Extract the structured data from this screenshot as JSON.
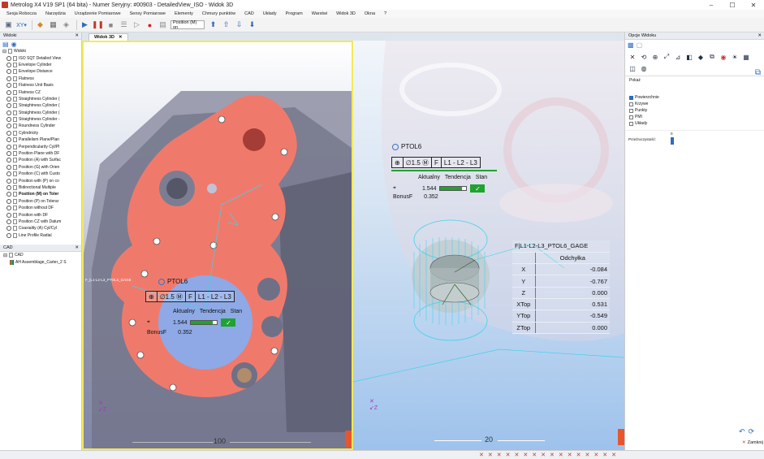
{
  "window": {
    "title": "Metrolog X4 V19 SP1 (64 bita) - Numer Seryjny: #00903 - DetailedView_ISO - Widok 3D"
  },
  "menu": [
    "Sesja Robocza",
    "Narzędzia",
    "Urządzenie Pomiarowe",
    "Sensy Pomiarowe",
    "Elementy",
    "Chmury punktów",
    "CAD",
    "Układy",
    "Program",
    "Warstwi",
    "Widok 3D",
    "Okna",
    "?"
  ],
  "toolbar": {
    "position_select": "Position (M) on"
  },
  "left_panel": {
    "views_header": "Widoki",
    "tree_root": "Widoki",
    "tree_items": [
      "ISO SQT Detailed View",
      "Envelope Cylinder",
      "Envelope Distance",
      "Flatness",
      "Flatness Unit Basis",
      "Flatness CZ",
      "Straightness Cylinder (",
      "Straightness Cylinder (",
      "Straightness Cylinder (",
      "Straightness Cylinder -",
      "Roundness Cylinder",
      "Cylindricity",
      "Parallelism Plane/Plan",
      "Perpendicularity Cyl/Pl",
      "Position Plane with DF",
      "Position (A) with Surfac",
      "Position (G) with Orien",
      "Position (C) with Custo",
      "Position with (P) on co",
      "Bidirectional Multiple",
      "Position (M) on Toler",
      "Position (P) on Tolerar",
      "Position without DF",
      "Position with DF",
      "Position CZ with Datum",
      "Coaxiality (A) Cyl/Cyl",
      "Line Profile Radial"
    ],
    "bold_index": 20,
    "cad_header": "CAD",
    "cad_root": "CAD",
    "cad_item": "AH Assemblage_Carter_2 S"
  },
  "tabs": {
    "view_tab": "Widok 3D"
  },
  "callout_left": {
    "name": "PTOL6",
    "fcf": [
      "⊕",
      "∅1.5 Ⓜ",
      "F",
      "L1 - L2 - L3"
    ],
    "head": [
      "Aktualny",
      "Tendencja",
      "Stan"
    ],
    "value": "1.544",
    "bar_fill": 0.82,
    "bonus_label": "BonusF",
    "bonus_value": "0.352",
    "check": "✓",
    "small_label": "F_|L1-L2-L3_PTOL6_GAGE"
  },
  "callout_right": {
    "name": "PTOL6",
    "fcf": [
      "⊕",
      "∅1.5 Ⓜ",
      "F",
      "L1 - L2 - L3"
    ],
    "head": [
      "Aktualny",
      "Tendencja",
      "Stan"
    ],
    "value": "1.544",
    "bar_fill": 0.82,
    "bonus_label": "BonusF",
    "bonus_value": "0.352",
    "check": "✓"
  },
  "deviation_table": {
    "title": "F|L1-L2-L3_PTOL6_GAGE",
    "column": "Odchyłka",
    "rows": [
      {
        "label": "X",
        "value": "-0.084"
      },
      {
        "label": "Y",
        "value": "-0.767"
      },
      {
        "label": "Z",
        "value": "0.000"
      },
      {
        "label": "XTop",
        "value": "0.531"
      },
      {
        "label": "YTop",
        "value": "-0.549"
      },
      {
        "label": "ZTop",
        "value": "0.000"
      }
    ]
  },
  "scales": {
    "left": "100",
    "right": "20"
  },
  "right_panel": {
    "header": "Opcje Widoku",
    "section": "Pokaż",
    "checks": [
      {
        "label": "Powierzchnie",
        "on": true
      },
      {
        "label": "Krzywe",
        "on": false
      },
      {
        "label": "Punkty",
        "on": false
      },
      {
        "label": "PMI",
        "on": false
      },
      {
        "label": "Układy",
        "on": false
      }
    ],
    "transparency_label": "Przeźroczystość:",
    "transparency_value": "0",
    "close_label": "Zamknij"
  },
  "colors": {
    "accent": "#2d6cc0",
    "highlight": "#ef7a6c",
    "ok": "#1fa32f",
    "frame": "#f3ea54"
  }
}
